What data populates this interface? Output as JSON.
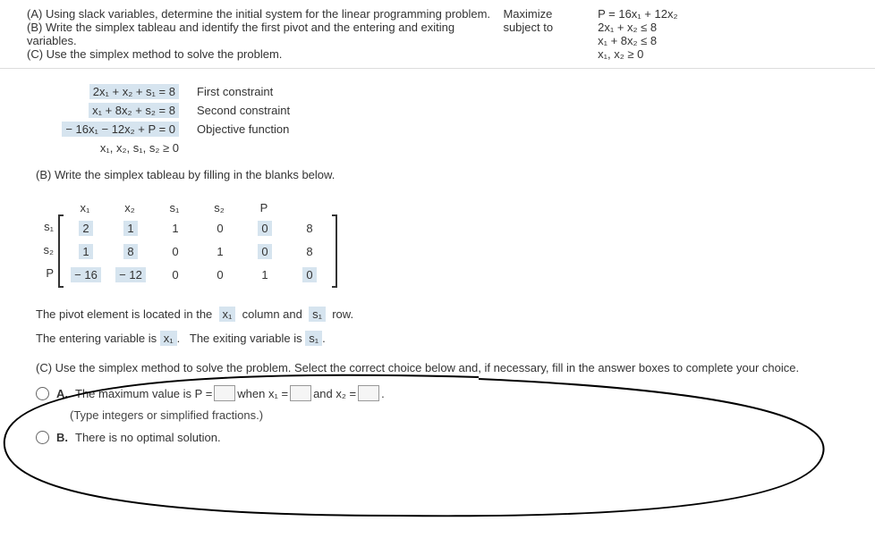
{
  "header": {
    "line_a": "(A) Using slack variables, determine the initial system for the linear programming problem.",
    "line_b": "(B) Write the simplex tableau and identify the first pivot and the entering and exiting variables.",
    "line_c": "(C) Use the simplex method to solve the problem.",
    "maximize": "Maximize",
    "subject_to": "subject to",
    "obj": "P = 16x₁ + 12x₂",
    "c1": "2x₁ + x₂ ≤ 8",
    "c2": "x₁ + 8x₂ ≤ 8",
    "c3": "x₁, x₂ ≥ 0"
  },
  "constraints": {
    "r1_eq": "2x₁ + x₂ + s₁ = 8",
    "r1_label": "First constraint",
    "r2_eq": "x₁ + 8x₂ + s₂ = 8",
    "r2_label": "Second constraint",
    "r3_eq": "− 16x₁ − 12x₂ + P = 0",
    "r3_label": "Objective function",
    "r4_eq": "x₁, x₂, s₁, s₂  ≥  0"
  },
  "part_b": {
    "intro": "(B) Write the simplex tableau by filling in the blanks below.",
    "headers": [
      "x₁",
      "x₂",
      "s₁",
      "s₂",
      "P",
      ""
    ],
    "rows": [
      {
        "label": "s₁",
        "cells": [
          "2",
          "1",
          "1",
          "0",
          "0",
          "8"
        ],
        "hl": [
          0,
          1,
          4
        ]
      },
      {
        "label": "s₂",
        "cells": [
          "1",
          "8",
          "0",
          "1",
          "0",
          "8"
        ],
        "hl": [
          0,
          1,
          4
        ]
      },
      {
        "label": "P",
        "cells": [
          "− 16",
          "− 12",
          "0",
          "0",
          "1",
          "0"
        ],
        "hl": [
          0,
          1,
          5
        ]
      }
    ],
    "pivot_text_1": "The pivot element is located in the",
    "pivot_col": "x₁",
    "pivot_text_2": "column and",
    "pivot_row": "s₁",
    "pivot_text_3": "row.",
    "enter_text": "The entering variable is",
    "enter_var": "x₁",
    "exit_text": "The exiting variable is",
    "exit_var": "s₁"
  },
  "part_c": {
    "intro": "(C) Use the simplex method to solve the problem. Select the correct choice below and, if necessary, fill in the answer boxes to complete your choice.",
    "opt_a_1": "The maximum value is P =",
    "opt_a_2": "when x₁ =",
    "opt_a_3": "and x₂ =",
    "hint": "(Type integers or simplified fractions.)",
    "opt_b": "There is no optimal solution."
  },
  "labels": {
    "A": "A.",
    "B": "B."
  }
}
